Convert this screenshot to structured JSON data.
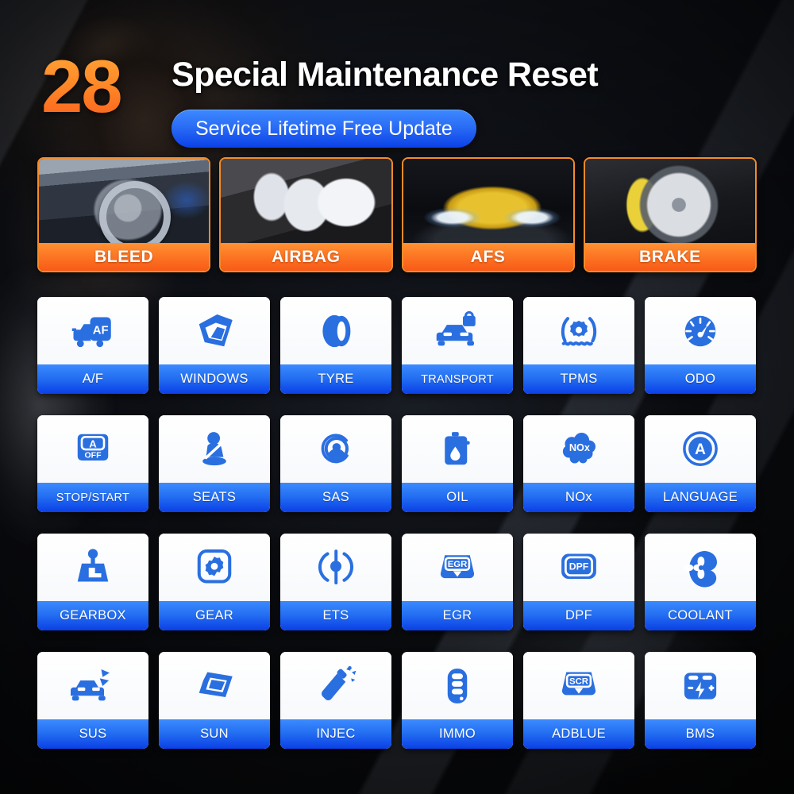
{
  "header": {
    "count": "28",
    "title": "Special Maintenance Reset",
    "badge": "Service Lifetime Free Update",
    "accent_orange": "#FF8A28",
    "accent_blue": "#2470F2"
  },
  "featured": [
    {
      "label": "BLEED",
      "icon": "steering-wheel-dashboard-photo"
    },
    {
      "label": "AIRBAG",
      "icon": "deployed-airbags-photo"
    },
    {
      "label": "AFS",
      "icon": "yellow-car-headlights-photo"
    },
    {
      "label": "BRAKE",
      "icon": "brake-disc-caliper-photo"
    }
  ],
  "grid": [
    [
      {
        "label": "A/F",
        "icon": "truck-af-icon"
      },
      {
        "label": "WINDOWS",
        "icon": "window-pane-icon"
      },
      {
        "label": "TYRE",
        "icon": "tyre-icon"
      },
      {
        "label": "TRANSPORT",
        "icon": "car-lock-icon"
      },
      {
        "label": "TPMS",
        "icon": "tyre-pressure-gear-icon"
      },
      {
        "label": "ODO",
        "icon": "speedometer-icon"
      }
    ],
    [
      {
        "label": "STOP/START",
        "icon": "auto-stop-start-off-icon"
      },
      {
        "label": "SEATS",
        "icon": "seatbelt-person-icon"
      },
      {
        "label": "SAS",
        "icon": "steering-angle-sensor-icon"
      },
      {
        "label": "OIL",
        "icon": "oil-can-icon"
      },
      {
        "label": "NOx",
        "icon": "nox-cloud-icon"
      },
      {
        "label": "LANGUAGE",
        "icon": "circled-a-icon"
      }
    ],
    [
      {
        "label": "GEARBOX",
        "icon": "gear-shifter-icon"
      },
      {
        "label": "GEAR",
        "icon": "gear-cog-square-icon"
      },
      {
        "label": "ETS",
        "icon": "electronic-throttle-icon"
      },
      {
        "label": "EGR",
        "icon": "egr-valve-icon"
      },
      {
        "label": "DPF",
        "icon": "dpf-filter-icon"
      },
      {
        "label": "COOLANT",
        "icon": "water-pump-impeller-icon"
      }
    ],
    [
      {
        "label": "SUS",
        "icon": "car-suspension-icon"
      },
      {
        "label": "SUN",
        "icon": "sunroof-icon"
      },
      {
        "label": "INJEC",
        "icon": "fuel-injector-icon"
      },
      {
        "label": "IMMO",
        "icon": "key-fob-icon"
      },
      {
        "label": "ADBLUE",
        "icon": "scr-adblue-icon"
      },
      {
        "label": "BMS",
        "icon": "battery-icon"
      }
    ]
  ]
}
